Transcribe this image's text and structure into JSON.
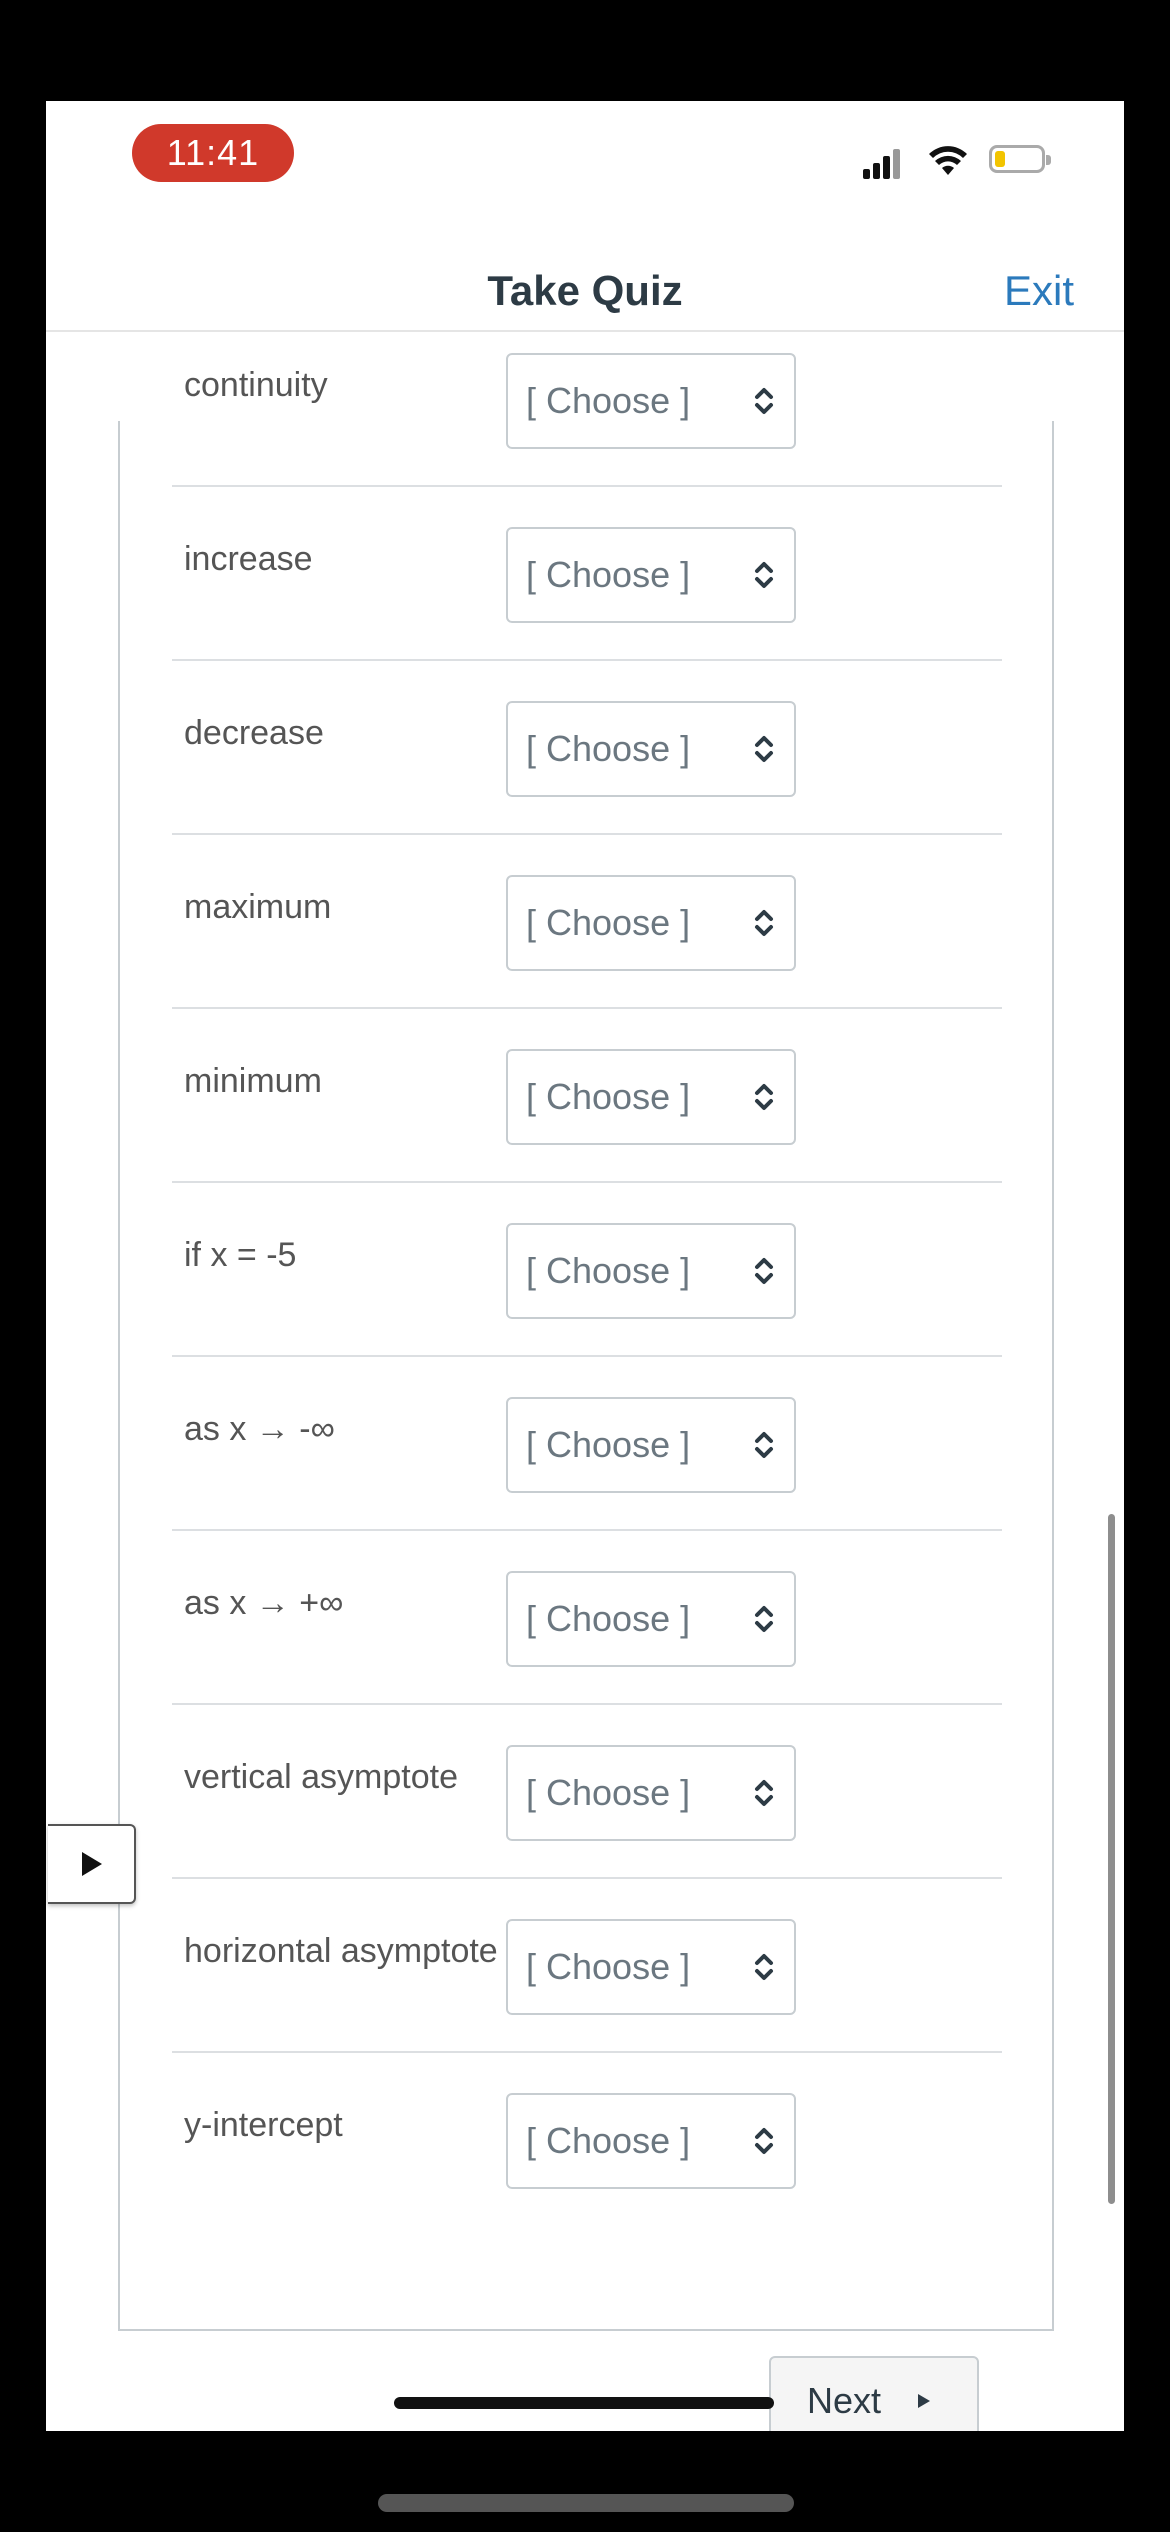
{
  "status_bar": {
    "time": "11:41"
  },
  "header": {
    "title": "Take Quiz",
    "exit_label": "Exit"
  },
  "rows": [
    {
      "label": "continuity",
      "value": "[ Choose ]"
    },
    {
      "label": "increase",
      "value": "[ Choose ]"
    },
    {
      "label": "decrease",
      "value": "[ Choose ]"
    },
    {
      "label": "maximum",
      "value": "[ Choose ]"
    },
    {
      "label": "minimum",
      "value": "[ Choose ]"
    },
    {
      "label": "if x = -5",
      "value": "[ Choose ]"
    },
    {
      "label": "as x → -∞",
      "value": "[ Choose ]"
    },
    {
      "label": "as x → +∞",
      "value": "[ Choose ]"
    },
    {
      "label": "vertical asymptote",
      "value": "[ Choose ]"
    },
    {
      "label": "horizontal asymptote",
      "value": "[ Choose ]"
    },
    {
      "label": "y-intercept",
      "value": "[ Choose ]"
    }
  ],
  "footer": {
    "next_label": "Next"
  },
  "colors": {
    "time_pill": "#d0392b",
    "link": "#2b7abc",
    "battery": "#f2c400"
  }
}
